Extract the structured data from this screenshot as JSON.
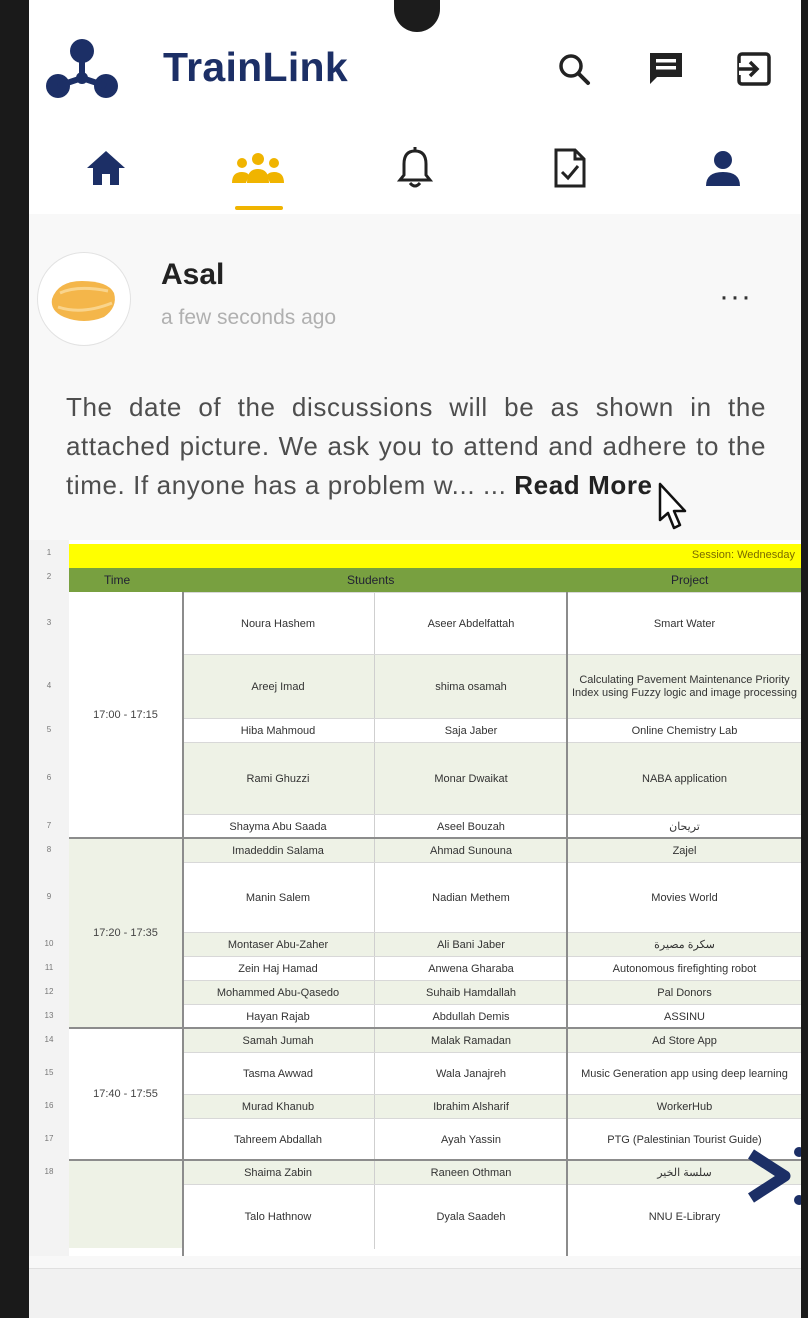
{
  "app": {
    "title": "TrainLink",
    "brand_color": "#1c2f66",
    "accent_color": "#f0b400",
    "top_actions": [
      {
        "icon": "search-icon"
      },
      {
        "icon": "chat-icon"
      },
      {
        "icon": "logout-icon"
      }
    ]
  },
  "tabs": [
    {
      "icon": "home-icon",
      "active": false
    },
    {
      "icon": "group-icon",
      "active": true
    },
    {
      "icon": "bell-icon",
      "active": false
    },
    {
      "icon": "document-check-icon",
      "active": false
    },
    {
      "icon": "profile-icon",
      "active": false
    }
  ],
  "post": {
    "author": "Asal",
    "time": "a few seconds ago",
    "menu_label": "···",
    "body": "The date of the discussions will be as shown in the attached picture. We ask you to attend and adhere to the time. If anyone has a problem w... ...",
    "read_more": "Read More",
    "image_next_icon": "chevron-right-icon"
  },
  "sheet": {
    "header1": "Session: Wednesday",
    "columns": [
      "Time",
      "Students",
      "Project"
    ],
    "row_numbers": [
      "1",
      "2",
      "3",
      "4",
      "5",
      "6",
      "7",
      "8",
      "9",
      "10",
      "11",
      "12",
      "13",
      "14",
      "15",
      "16",
      "17",
      "18"
    ],
    "groups": [
      {
        "time": "17:00 - 17:15"
      },
      {
        "time": "17:20 - 17:35"
      },
      {
        "time": "17:40 - 17:55"
      },
      {
        "time": ""
      }
    ],
    "rows": [
      {
        "s1": "Noura Hashem",
        "s2": "Aseer Abdelfattah",
        "project": "Smart Water"
      },
      {
        "s1": "Areej Imad",
        "s2": "shima osamah",
        "project": "Calculating Pavement Maintenance Priority Index using Fuzzy logic and image processing"
      },
      {
        "s1": "Hiba Mahmoud",
        "s2": "Saja Jaber",
        "project": "Online Chemistry Lab"
      },
      {
        "s1": "Rami Ghuzzi",
        "s2": "Monar Dwaikat",
        "project": "NABA application"
      },
      {
        "s1": "Shayma Abu Saada",
        "s2": "Aseel Bouzah",
        "project": "تريحان"
      },
      {
        "s1": "Imadeddin Salama",
        "s2": "Ahmad Sunouna",
        "project": "Zajel"
      },
      {
        "s1": "Manin Salem",
        "s2": "Nadian Methem",
        "project": "Movies World"
      },
      {
        "s1": "Montaser Abu-Zaher",
        "s2": "Ali Bani Jaber",
        "project": "سكرة مصيرة"
      },
      {
        "s1": "Zein Haj Hamad",
        "s2": "Anwena Gharaba",
        "project": "Autonomous firefighting robot"
      },
      {
        "s1": "Mohammed Abu-Qasedo",
        "s2": "Suhaib Hamdallah",
        "project": "Pal Donors"
      },
      {
        "s1": "Hayan Rajab",
        "s2": "Abdullah Demis",
        "project": "ASSINU"
      },
      {
        "s1": "Samah Jumah",
        "s2": "Malak Ramadan",
        "project": "Ad Store App"
      },
      {
        "s1": "Tasma Awwad",
        "s2": "Wala Janajreh",
        "project": "Music Generation app using deep learning"
      },
      {
        "s1": "Murad Khanub",
        "s2": "Ibrahim Alsharif",
        "project": "WorkerHub"
      },
      {
        "s1": "Tahreem Abdallah",
        "s2": "Ayah Yassin",
        "project": "PTG (Palestinian Tourist Guide)"
      },
      {
        "s1": "Shaima Zabin",
        "s2": "Raneen Othman",
        "project": "سلسة الخير"
      },
      {
        "s1": "Talo Hathnow",
        "s2": "Dyala Saadeh",
        "project": "NNU E-Library"
      }
    ]
  }
}
